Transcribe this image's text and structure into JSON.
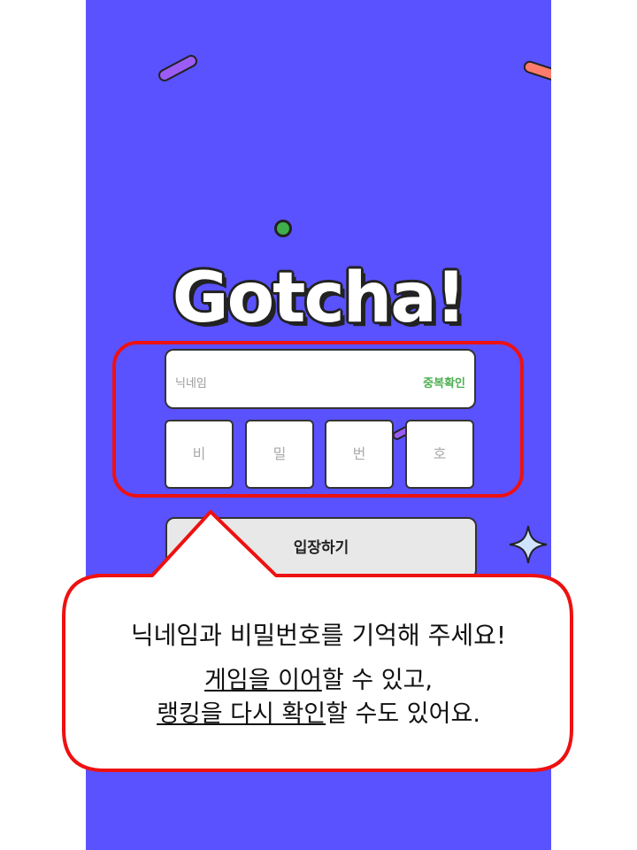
{
  "app": {
    "title": "Gotcha!"
  },
  "form": {
    "nickname_placeholder": "닉네임",
    "duplicate_check_label": "중복확인",
    "password_boxes": [
      "비",
      "밀",
      "번",
      "호"
    ],
    "enter_button_label": "입장하기"
  },
  "callout": {
    "line1": "닉네임과 비밀번호를 기억해 주세요!",
    "line2_underlined": "게임을 이어",
    "line2_rest": "할 수 있고,",
    "line3_underlined": "랭킹을 다시 확인",
    "line3_rest": "할 수도 있어요."
  },
  "colors": {
    "background": "#5a52ff",
    "highlight": "#ee1111",
    "duplicate_check": "#4caf50"
  }
}
